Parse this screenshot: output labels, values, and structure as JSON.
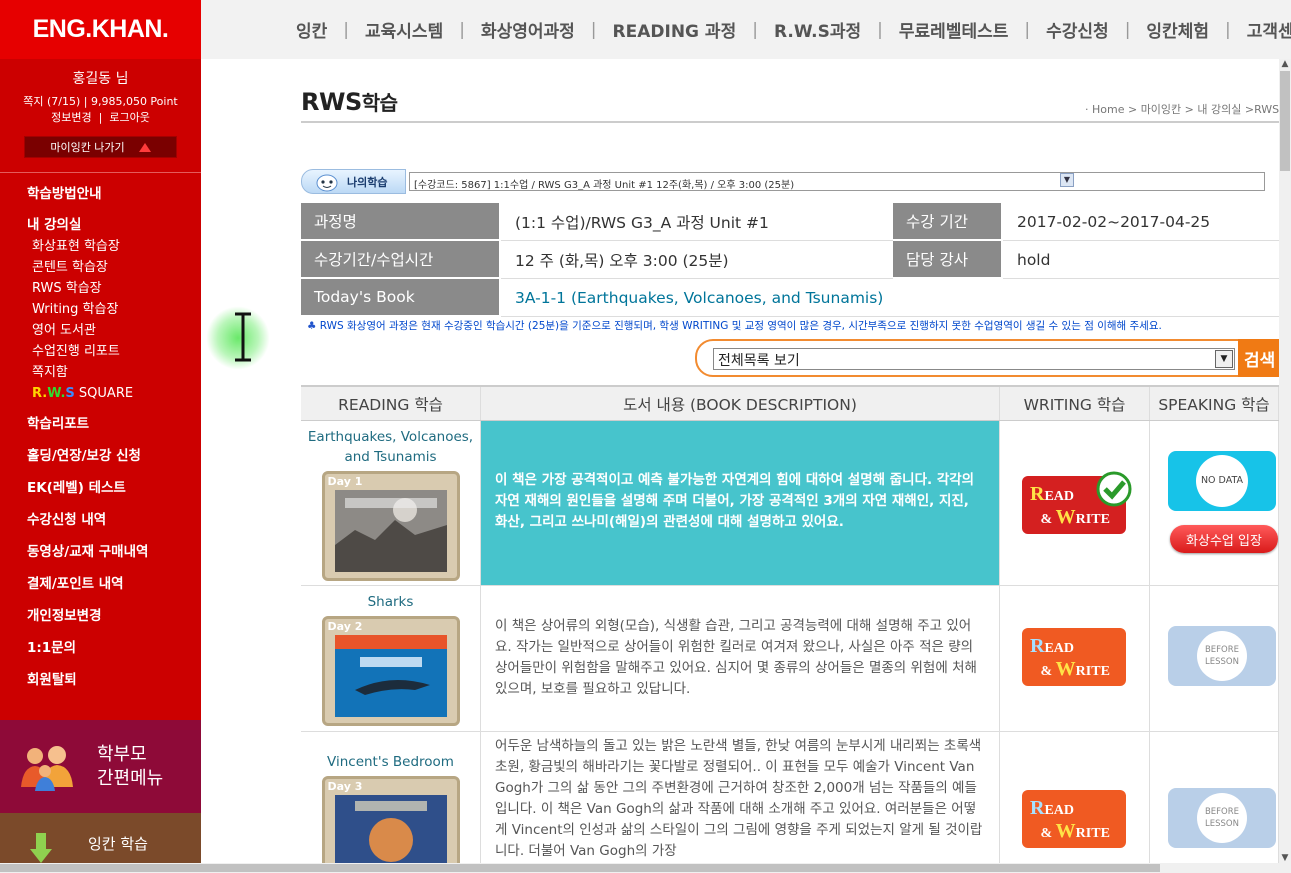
{
  "brand": {
    "logo_text": "ENG.KHAN."
  },
  "user": {
    "name": "홍길동 님",
    "meta": "쪽지 (7/15)  |  9,985,050 Point",
    "link_profile": "정보변경",
    "link_logout": "로그아웃",
    "myikan_button": "마이잉칸  나가기"
  },
  "sidebar": {
    "guide": "학습방법안내",
    "my_class": "내 강의실",
    "sub_items": [
      "화상표현 학습장",
      "콘텐트 학습장",
      "RWS 학습장",
      "Writing 학습장",
      "영어 도서관",
      "수업진행 리포트",
      "쪽지함"
    ],
    "rws_square": {
      "r": "R.",
      "w": "W.",
      "s": "S",
      "rest": " SQUARE"
    },
    "menu": [
      "학습리포트",
      "홀딩/연장/보강 신청",
      "EK(레벨) 테스트",
      "수강신청 내역",
      "동영상/교재 구매내역",
      "결제/포인트 내역",
      "개인정보변경",
      "1:1문의",
      "회원탈퇴"
    ],
    "parent_menu_line1": "학부모",
    "parent_menu_line2": "간편메뉴",
    "learn_label": "잉칸 학습"
  },
  "topnav": {
    "items": [
      "잉칸",
      "교육시스템",
      "화상영어과정",
      "READING 과정",
      "R.W.S과정",
      "무료레벨테스트",
      "수강신청",
      "잉칸체험",
      "고객센터"
    ]
  },
  "page": {
    "title": "RWS",
    "title_suffix": "학습",
    "breadcrumb": "· Home > 마이잉칸 > 내 강의실 >RWS 학습"
  },
  "my_learning": {
    "tab_label": "나의학습",
    "selected_course": "[수강코드: 5867] 1:1수업 / RWS G3_A 과정 Unit #1 12주(화,목) / 오후 3:00 (25분)"
  },
  "info": {
    "course_name_label": "과정명",
    "course_name": "(1:1 수업)/RWS G3_A 과정 Unit #1",
    "period_label": "수강 기간",
    "period": "2017-02-02~2017-04-25",
    "schedule_label": "수강기간/수업시간",
    "schedule": "12 주 (화,목) 오후 3:00 (25분)",
    "teacher_label": "담당 강사",
    "teacher": "hold",
    "book_label": "Today's Book",
    "book": "3A-1-1 (Earthquakes, Volcanoes, and Tsunamis)"
  },
  "notice": {
    "icon": "♣",
    "text": " RWS 화상영어 과정은 현재 수강중인 학습시간 (25분)을 기준으로 진행되며, 학생 WRITING 및 교정 영역이 많은 경우, 시간부족으로 진행하지 못한 수업영역이 생길 수 있는 점 이해해 주세요."
  },
  "filter": {
    "selected": "전체목록 보기",
    "search_label": "검색"
  },
  "book_table": {
    "headers": [
      "READING 학습",
      "도서 내용 (BOOK DESCRIPTION)",
      "WRITING 학습",
      "SPEAKING 학습"
    ],
    "rw_button": {
      "r": "R",
      "ead": "EAD",
      "amp": "& ",
      "w": "W",
      "rite": "RITE"
    },
    "no_data": "NO DATA",
    "before_lesson": "BEFORE LESSON",
    "enter_button": "화상수업 입장",
    "rows": [
      {
        "title": "Earthquakes, Volcanoes, and Tsunamis",
        "day": "Day 1",
        "description": "이 책은 가장 공격적이고 예측 불가능한 자연계의 힘에 대하여 설명해 줍니다. 각각의 자연 재해의 원인들을 설명해 주며 더불어, 가장 공격적인 3개의 자연 재해인, 지진, 화산, 그리고 쓰나미(해일)의 관련성에 대해 설명하고 있어요."
      },
      {
        "title": "Sharks",
        "day": "Day 2",
        "description": "이 책은 상어류의 외형(모습), 식생활 습관, 그리고 공격능력에 대해 설명해 주고 있어요. 작가는 일반적으로 상어들이 위험한 킬러로 여겨져 왔으나, 사실은 아주 적은 량의 상어들만이 위험함을 말해주고 있어요. 심지어 몇 종류의 상어들은 멸종의 위험에 처해 있으며, 보호를 필요하고 있답니다."
      },
      {
        "title": "Vincent's Bedroom",
        "day": "Day 3",
        "description": "어두운 남색하늘의 돌고 있는 밝은 노란색 별들, 한낮 여름의 눈부시게 내리쬐는 초록색 초원, 황금빛의 해바라기는 꽃다발로 정렬되어.. 이 표현들 모두 예술가 Vincent Van Gogh가 그의 삶 동안 그의 주변환경에 근거하여 창조한 2,000개 넘는 작품들의 예들입니다. 이 책은 Van Gogh의 삶과 작품에 대해 소개해 주고 있어요. 여러분들은 어떻게 Vincent의 인성과 삶의 스타일이 그의 그림에 영향을 주게 되었는지 알게 될 것이랍니다. 더불어 Van Gogh의 가장"
      }
    ]
  },
  "colors": {
    "sidebar": "#cc0000",
    "accent_teal": "#47c4cc",
    "orange": "#f07a14"
  }
}
